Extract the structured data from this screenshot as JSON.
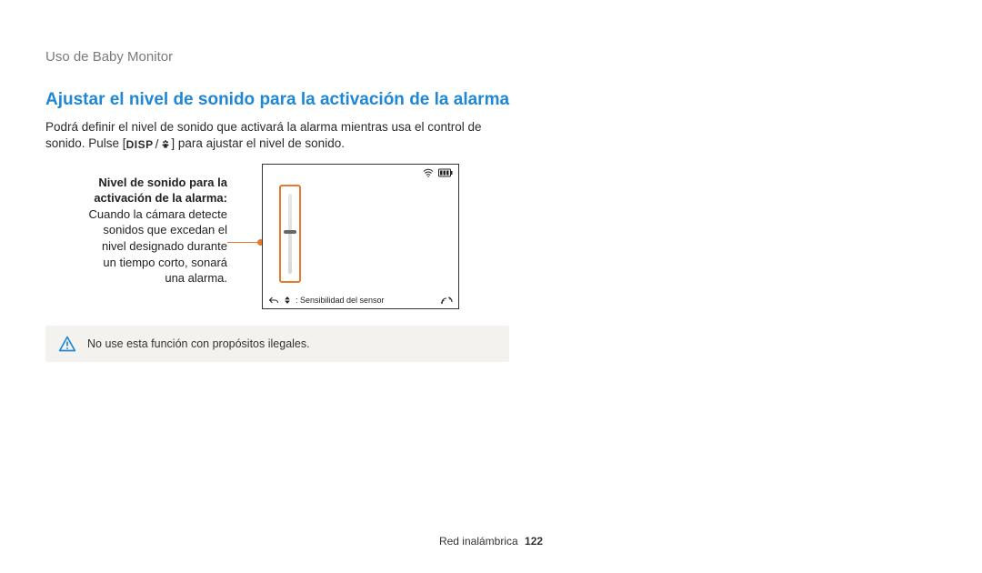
{
  "breadcrumb": "Uso de Baby Monitor",
  "heading": "Ajustar el nivel de sonido para la activación de la alarma",
  "intro_part1": "Podrá definir el nivel de sonido que activará la alarma mientras usa el control de sonido. Pulse [",
  "intro_disp": "DISP",
  "intro_slash": "/",
  "intro_part2": "] para ajustar el nivel de sonido.",
  "caption": {
    "bold1": "Nivel de sonido para la",
    "bold2": "activación de la alarma:",
    "line1": "Cuando la cámara detecte",
    "line2": "sonidos que excedan el",
    "line3": "nivel designado durante",
    "line4": "un tiempo corto, sonará",
    "line5": "una alarma."
  },
  "screen": {
    "sensitivity_label": ": Sensibilidad del sensor"
  },
  "warning_text": "No use esta función con propósitos ilegales.",
  "footer_section": "Red inalámbrica",
  "footer_page": "122"
}
